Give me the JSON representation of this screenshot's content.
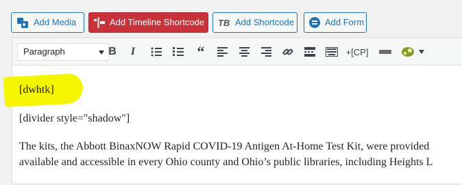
{
  "media_buttons": [
    {
      "label": "Add Media",
      "icon": "media-icon"
    },
    {
      "label": "Add Timeline Shortcode",
      "icon": "timeline-icon"
    },
    {
      "label": "Add Shortcode",
      "icon": "tb-shortcode-icon"
    },
    {
      "label": "Add Form",
      "icon": "form-icon"
    }
  ],
  "toolbar": {
    "format_select": "Paragraph",
    "cp_label": "+[CP]",
    "buttons": [
      "bold",
      "italic",
      "bullet-list",
      "numbered-list",
      "blockquote",
      "align-left",
      "align-center",
      "align-right",
      "link",
      "read-more",
      "toolbar-toggle",
      "cp",
      "shortcode",
      "timeline"
    ]
  },
  "content": {
    "line1": "[dwhtk]",
    "line2": "[divider style=\"shadow\"]",
    "line3": "The kits, the Abbott BinaxNOW Rapid COVID-19 Antigen At-Home Test Kit, were provided",
    "line4": "available and accessible in every Ohio county and Ohio’s public libraries, including Heights L"
  },
  "colors": {
    "accent": "#2271b1",
    "timeline_button": "#c8323a",
    "highlight": "#f5f500"
  }
}
